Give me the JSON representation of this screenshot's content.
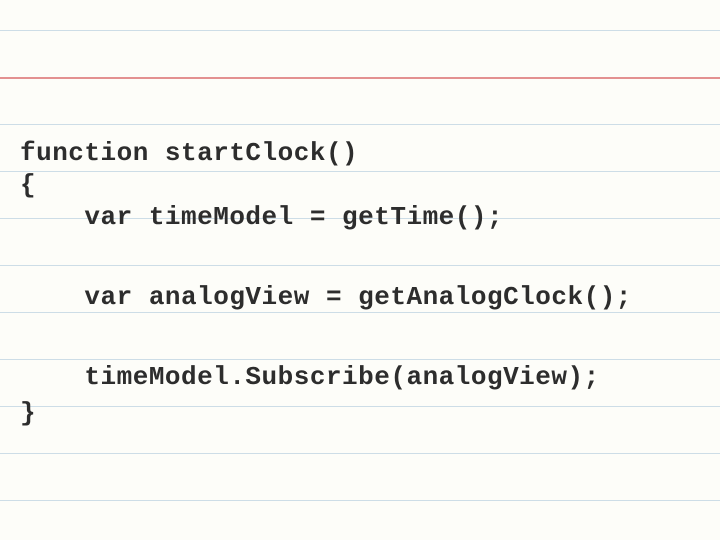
{
  "code": {
    "l1": "function startClock()",
    "l2": "{",
    "l3": "    var timeModel = getTime();",
    "l4": "    var analogView = getAnalogClock();",
    "l5": "    timeModel.Subscribe(analogView);",
    "l6": "}"
  }
}
